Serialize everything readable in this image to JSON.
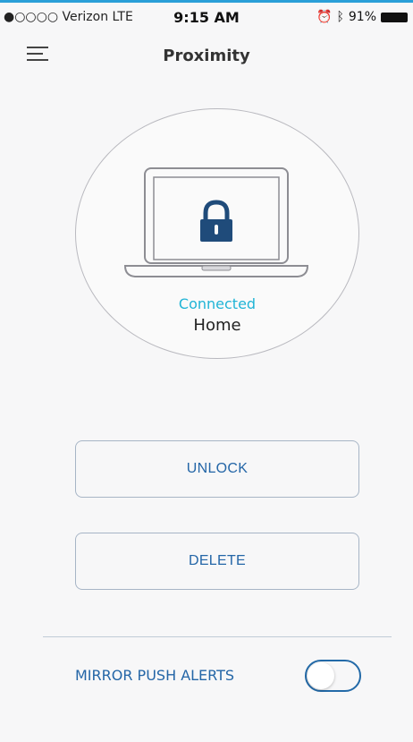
{
  "status_bar": {
    "carrier": "●○○○○ Verizon  LTE",
    "time": "9:15 AM",
    "alarm_icon": "alarm-clock-icon",
    "bluetooth_icon": "bluetooth-icon",
    "battery_percent": "91%",
    "battery_icon": "battery-icon"
  },
  "nav": {
    "title": "Proximity",
    "menu_icon": "hamburger-menu-icon"
  },
  "device": {
    "icon": "laptop-lock-icon",
    "status": "Connected",
    "name": "Home"
  },
  "buttons": {
    "unlock_label": "UNLOCK",
    "delete_label": "DELETE"
  },
  "settings": {
    "mirror_push_alerts_label": "MIRROR PUSH ALERTS",
    "mirror_push_alerts_enabled": false
  },
  "colors": {
    "accent_blue": "#2466a7",
    "connected_cyan": "#20b4d6",
    "lock_navy": "#1f4b7a"
  }
}
